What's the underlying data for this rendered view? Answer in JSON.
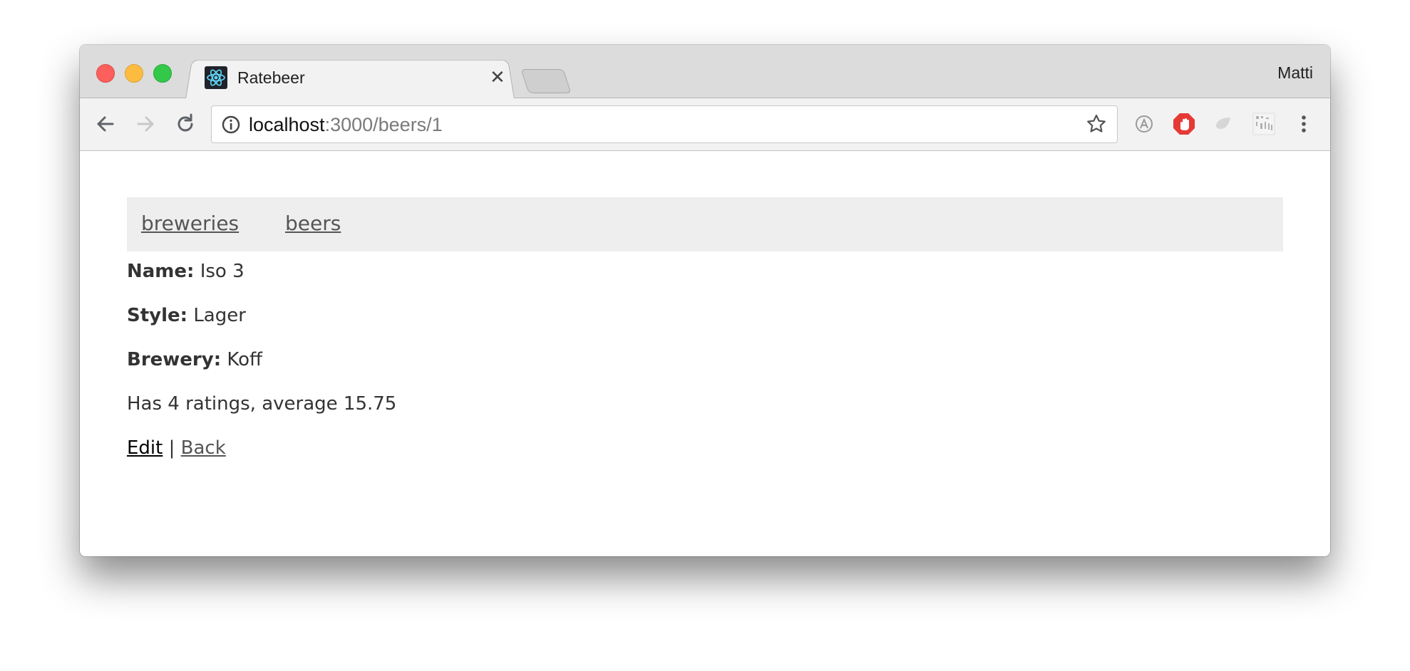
{
  "browser": {
    "tab_title": "Ratebeer",
    "profile_name": "Matti",
    "url_host": "localhost",
    "url_path": ":3000/beers/1",
    "icons": [
      "back-icon",
      "forward-icon",
      "reload-icon",
      "info-icon",
      "star-icon",
      "translate-icon",
      "adblock-icon",
      "extension-icon",
      "qr-icon",
      "menu-icon"
    ]
  },
  "nav": {
    "breweries": "breweries",
    "beers": "beers"
  },
  "beer": {
    "name_label": "Name:",
    "name": "Iso 3",
    "style_label": "Style:",
    "style": "Lager",
    "brewery_label": "Brewery:",
    "brewery": "Koff",
    "ratings_text": "Has 4 ratings, average 15.75"
  },
  "actions": {
    "edit": "Edit",
    "separator": "|",
    "back": "Back"
  },
  "colors": {
    "nav_bg": "#eeeeee",
    "link": "#555555",
    "edit_link": "#000000"
  }
}
